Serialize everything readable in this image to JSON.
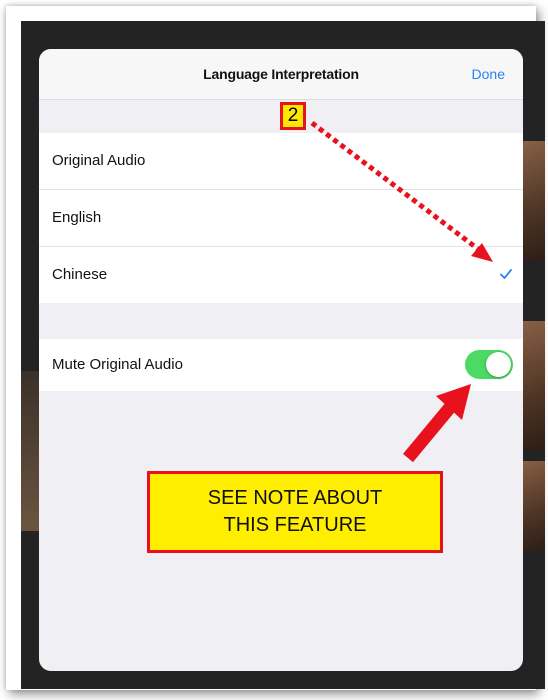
{
  "dialog": {
    "title": "Language Interpretation",
    "done_label": "Done"
  },
  "languages": [
    {
      "label": "Original Audio",
      "selected": false
    },
    {
      "label": "English",
      "selected": false
    },
    {
      "label": "Chinese",
      "selected": true
    }
  ],
  "settings": {
    "mute_label": "Mute Original Audio",
    "mute_enabled": true
  },
  "annotations": {
    "step_number": "2",
    "note_line1": "SEE NOTE ABOUT",
    "note_line2": "THIS FEATURE"
  },
  "colors": {
    "accent": "#2b82f6",
    "toggle_on": "#4cd964",
    "callout_fill": "#ffee00",
    "callout_border": "#e8121c"
  },
  "icons": {
    "checkmark": "checkmark-icon"
  }
}
